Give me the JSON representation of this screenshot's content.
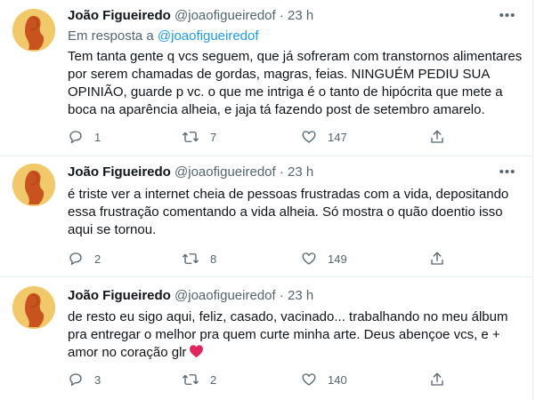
{
  "colors": {
    "accent": "#1d9bf0",
    "muted": "#536471",
    "text": "#0f1419",
    "divider": "#e6ecf0",
    "heart": "#e0245e"
  },
  "tweets": [
    {
      "name": "João Figueiredo",
      "handle": "@joaofigueiredof",
      "dot": "·",
      "time": "23 h",
      "reply_prefix": "Em resposta a",
      "reply_mention": "@joaofigueiredof",
      "lines": [
        "Tem tanta gente q vcs seguem, que já sofreram com transtornos alimentares",
        "por serem chamadas de gordas, magras, feias. NINGUÉM PEDIU SUA",
        "OPINIÃO, guarde p vc. o que me intriga é o tanto de hipócrita que mete a",
        "boca na aparência alheia, e jaja  tá fazendo post de setembro amarelo."
      ],
      "replies": "1",
      "retweets": "7",
      "likes": "147"
    },
    {
      "name": "João Figueiredo",
      "handle": "@joaofigueiredof",
      "dot": "·",
      "time": "23 h",
      "lines": [
        "é triste ver a internet cheia de pessoas frustradas com a vida, depositando",
        "essa frustração comentando a vida alheia. Só mostra o quão doentio isso",
        "aqui se tornou."
      ],
      "replies": "2",
      "retweets": "8",
      "likes": "149"
    },
    {
      "name": "João Figueiredo",
      "handle": "@joaofigueiredof",
      "dot": "·",
      "time": "23 h",
      "lines": [
        "de resto eu sigo aqui, feliz, casado, vacinado... trabalhando no meu álbum",
        "pra entregar o melhor pra quem curte minha arte. Deus abençoe vcs, e +",
        "amor no coração glr"
      ],
      "emoji": "red-heart",
      "replies": "3",
      "retweets": "2",
      "likes": "140"
    }
  ]
}
